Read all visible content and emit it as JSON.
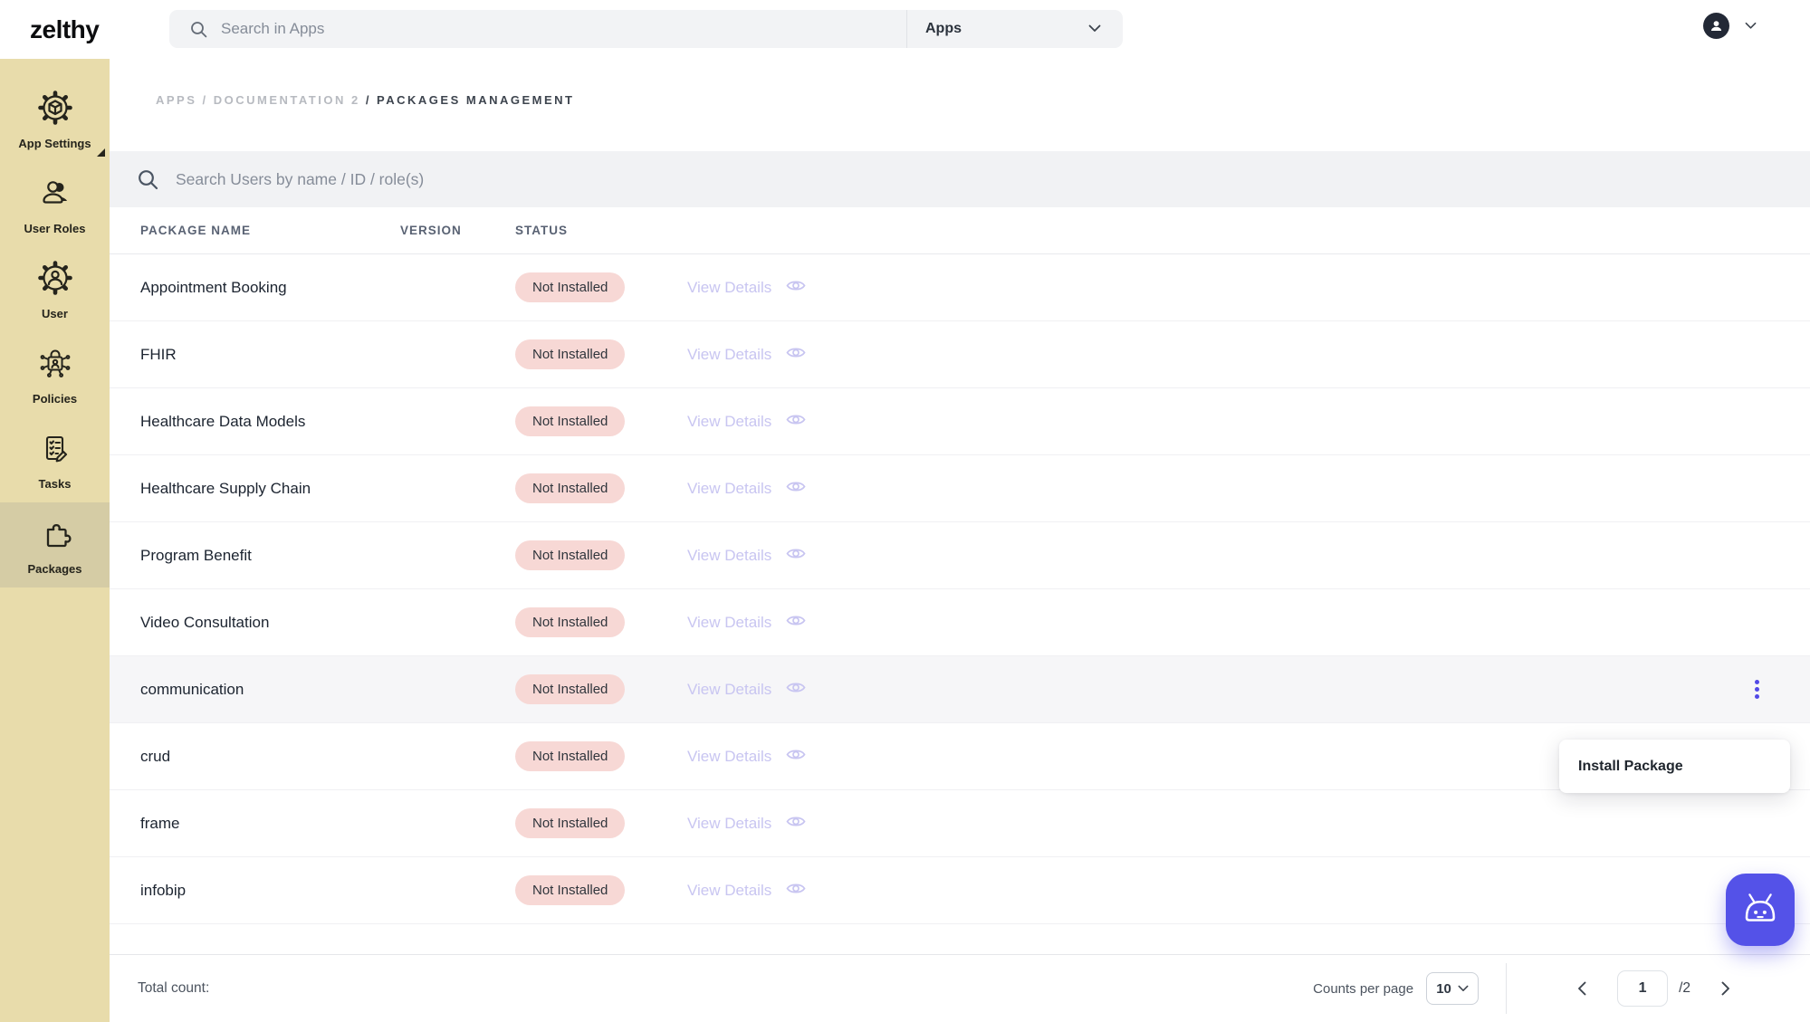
{
  "brand": {
    "logo_text": "zelthy"
  },
  "topbar": {
    "search": {
      "placeholder": "Search in Apps"
    },
    "scope": {
      "selected": "Apps"
    }
  },
  "sidebar": {
    "items": [
      {
        "label": "App Settings",
        "icon": "app-settings-gear-cube-icon",
        "active": false,
        "expandable": true
      },
      {
        "label": "User Roles",
        "icon": "user-roles-icon",
        "active": false
      },
      {
        "label": "User",
        "icon": "user-gear-icon",
        "active": false
      },
      {
        "label": "Policies",
        "icon": "policies-lock-circuit-icon",
        "active": false
      },
      {
        "label": "Tasks",
        "icon": "tasks-checklist-icon",
        "active": false
      },
      {
        "label": "Packages",
        "icon": "packages-puzzle-icon",
        "active": true
      }
    ]
  },
  "breadcrumb": {
    "path": "APPS / DOCUMENTATION 2",
    "current": "/ PACKAGES MANAGEMENT"
  },
  "search_bar": {
    "placeholder": "Search Users by name / ID / role(s)"
  },
  "table": {
    "columns": [
      "PACKAGE NAME",
      "VERSION",
      "STATUS"
    ],
    "rows": [
      {
        "name": "Appointment Booking",
        "version": "",
        "status": "Not Installed",
        "action": "View Details",
        "highlighted": false,
        "menu_open": false
      },
      {
        "name": "FHIR",
        "version": "",
        "status": "Not Installed",
        "action": "View Details",
        "highlighted": false,
        "menu_open": false
      },
      {
        "name": "Healthcare Data Models",
        "version": "",
        "status": "Not Installed",
        "action": "View Details",
        "highlighted": false,
        "menu_open": false
      },
      {
        "name": "Healthcare Supply Chain",
        "version": "",
        "status": "Not Installed",
        "action": "View Details",
        "highlighted": false,
        "menu_open": false
      },
      {
        "name": "Program Benefit",
        "version": "",
        "status": "Not Installed",
        "action": "View Details",
        "highlighted": false,
        "menu_open": false
      },
      {
        "name": "Video Consultation",
        "version": "",
        "status": "Not Installed",
        "action": "View Details",
        "highlighted": false,
        "menu_open": false
      },
      {
        "name": "communication",
        "version": "",
        "status": "Not Installed",
        "action": "View Details",
        "highlighted": true,
        "menu_open": true
      },
      {
        "name": "crud",
        "version": "",
        "status": "Not Installed",
        "action": "View Details",
        "highlighted": false,
        "menu_open": false
      },
      {
        "name": "frame",
        "version": "",
        "status": "Not Installed",
        "action": "View Details",
        "highlighted": false,
        "menu_open": false
      },
      {
        "name": "infobip",
        "version": "",
        "status": "Not Installed",
        "action": "View Details",
        "highlighted": false,
        "menu_open": false
      }
    ]
  },
  "context_menu": {
    "items": [
      {
        "label": "Install Package"
      }
    ]
  },
  "footer": {
    "total_label": "Total count:",
    "counts_per_page_label": "Counts per page",
    "counts_per_page_value": "10",
    "page_current": "1",
    "page_total": "/2"
  },
  "colors": {
    "accent": "#5149e6",
    "sidebar_bg": "#e8dcab",
    "sidebar_active_bg": "#d5cca5",
    "badge_bg": "#f7d8d5",
    "link_lavender": "#c8c5f1",
    "bot_button": "#5452e8"
  }
}
